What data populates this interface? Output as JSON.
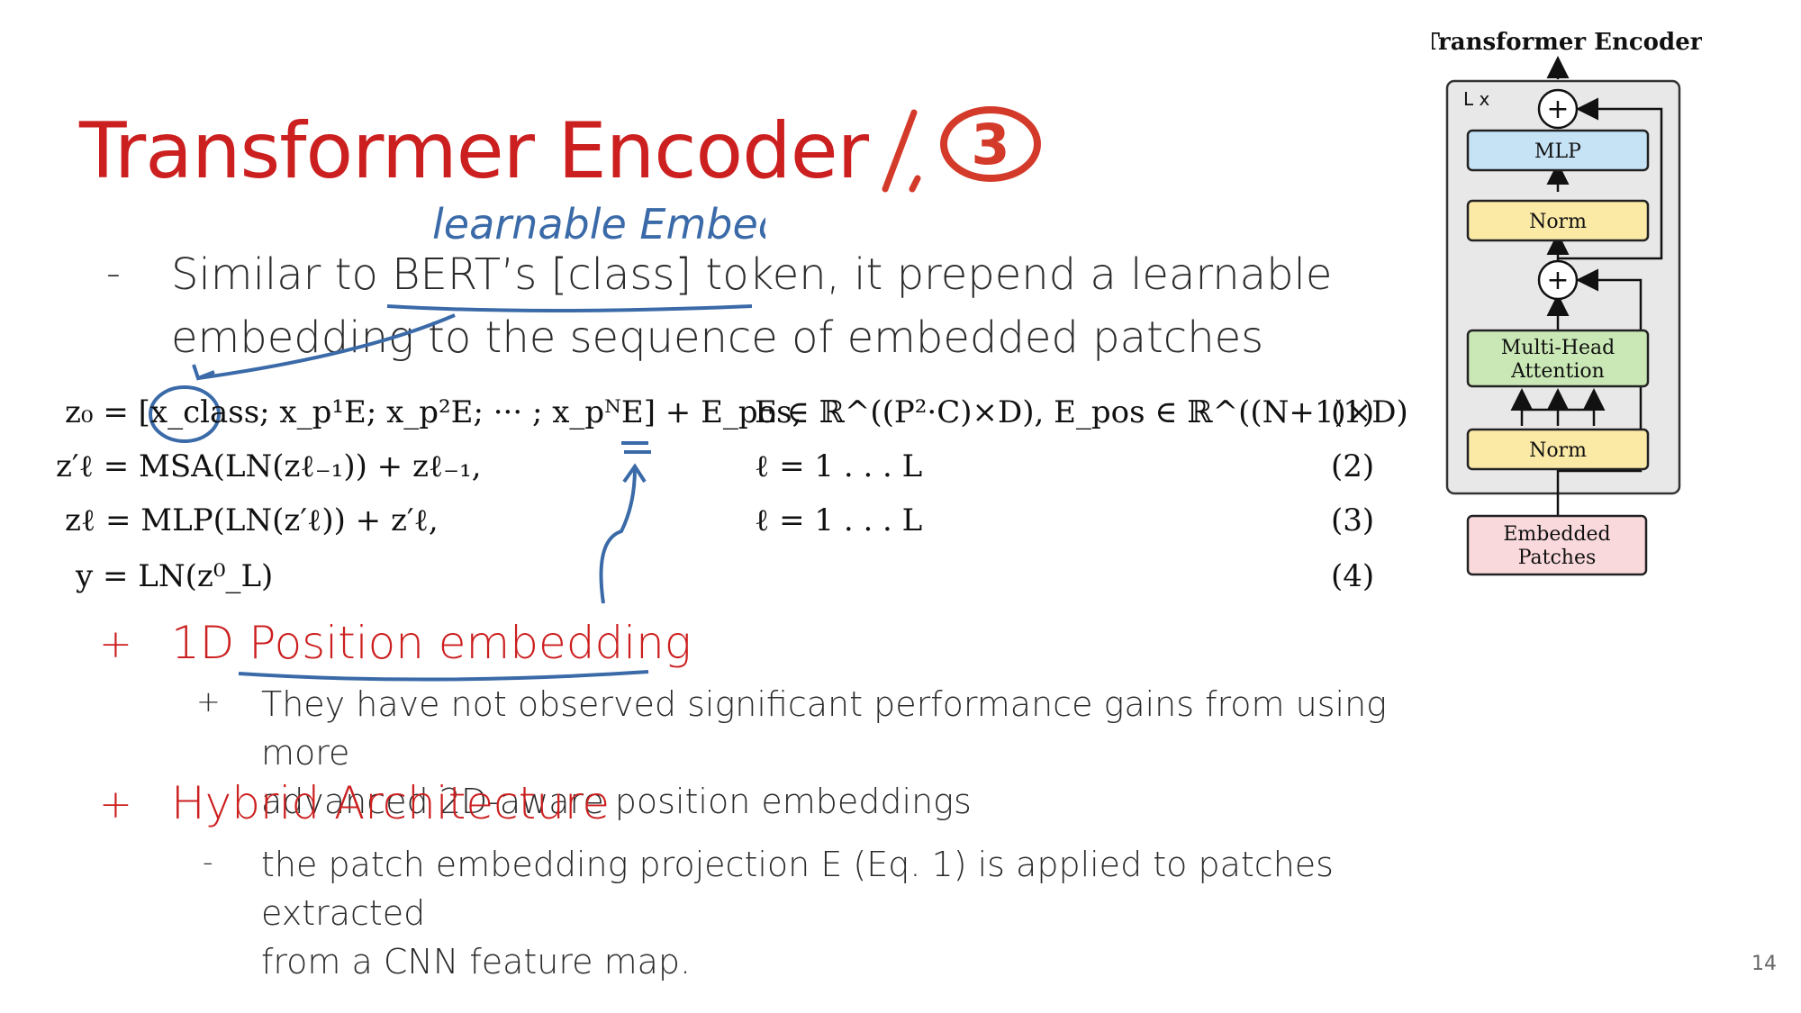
{
  "slide": {
    "title": "Transformer Encoder",
    "page_number": "14",
    "annotation_step": "/. 3",
    "handwritten_note": "learnable Embedding"
  },
  "bullets": {
    "mark_dash": "-",
    "intro_line1": "Similar to BERT’s [class] token, it prepend a learnable",
    "intro_line2": "embedding to the sequence of embedded patches",
    "mark_plus": "+",
    "position_heading": "1D Position embedding",
    "position_sub_line1": "They have not observed significant performance gains from using more",
    "position_sub_line2": "advanced 2D-aware position embeddings",
    "hybrid_heading": "Hybrid Architecture",
    "hybrid_sub_line1": "the patch embedding projection E (Eq. 1) is applied to patches extracted",
    "hybrid_sub_line2": "from a CNN feature map."
  },
  "equations": [
    {
      "lhs": "z₀ = [x_class; x_p¹E; x_p²E; ··· ; x_pᴺE] + E_pos,",
      "cond": "E ∈ ℝ^((P²·C)×D), E_pos ∈ ℝ^((N+1)×D)",
      "num": "(1)"
    },
    {
      "lhs": "z′ℓ = MSA(LN(zℓ₋₁)) + zℓ₋₁,",
      "cond": "ℓ = 1 . . . L",
      "num": "(2)"
    },
    {
      "lhs": "zℓ = MLP(LN(z′ℓ)) + z′ℓ,",
      "cond": "ℓ = 1 . . . L",
      "num": "(3)"
    },
    {
      "lhs": "y = LN(z⁰_L)",
      "cond": "",
      "num": "(4)"
    }
  ],
  "diagram": {
    "title": "Transformer Encoder",
    "repeat_label": "L x",
    "plus_symbol": "+",
    "mlp": "MLP",
    "norm_top": "Norm",
    "attention_line1": "Multi-Head",
    "attention_line2": "Attention",
    "norm_bottom": "Norm",
    "input_line1": "Embedded",
    "input_line2": "Patches",
    "colors": {
      "mlp": "#c6e2f5",
      "norm": "#fbe9a6",
      "attention": "#c9e8b5",
      "input": "#f9d9dc",
      "block_bg": "#e8e8e8"
    }
  }
}
